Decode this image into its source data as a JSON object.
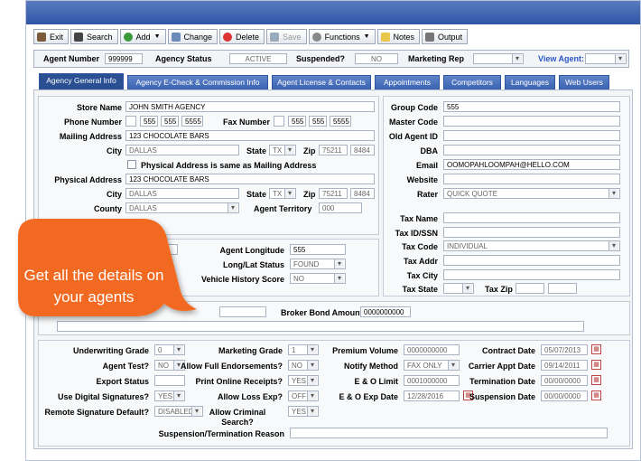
{
  "toolbar": {
    "exit": "Exit",
    "search": "Search",
    "add": "Add",
    "change": "Change",
    "delete": "Delete",
    "save": "Save",
    "functions": "Functions",
    "notes": "Notes",
    "output": "Output"
  },
  "header": {
    "agent_number_label": "Agent Number",
    "agent_number": "999999",
    "agent_status_label": "Agency Status",
    "agent_status": "ACTIVE",
    "suspended_label": "Suspended?",
    "suspended": "NO",
    "marketing_rep_label": "Marketing Rep",
    "view_agent_label": "View Agent:"
  },
  "tabs": [
    "Agency General Info",
    "Agency E-Check & Commission Info",
    "Agent License & Contacts",
    "Appointments",
    "Competitors",
    "Languages",
    "Web Users"
  ],
  "general": {
    "store_name_label": "Store Name",
    "store_name": "JOHN SMITH AGENCY",
    "phone_label": "Phone Number",
    "phone": [
      "555",
      "555",
      "5555"
    ],
    "fax_label": "Fax Number",
    "fax": [
      "555",
      "555",
      "5555"
    ],
    "mailing_label": "Mailing Address",
    "mailing": "123 CHOCOLATE BARS",
    "city_label": "City",
    "city": "DALLAS",
    "state_label": "State",
    "state": "TX",
    "zip_label": "Zip",
    "zip": "75211",
    "zip4": "8484",
    "same_as_mailing": "Physical Address is same as Mailing Address",
    "physical_label": "Physical Address",
    "physical": "123 CHOCOLATE BARS",
    "city2": "DALLAS",
    "state2": "TX",
    "zip2": "75211",
    "zip4_2": "8484",
    "county_label": "County",
    "county": "DALLAS",
    "territory_label": "Agent Territory",
    "territory": "000"
  },
  "right": {
    "group_code_label": "Group Code",
    "group_code": "555",
    "master_code_label": "Master Code",
    "old_agent_label": "Old Agent ID",
    "dba_label": "DBA",
    "email_label": "Email",
    "email": "OOMOPAHLOOMPAH@HELLO.COM",
    "website_label": "Website",
    "rater_label": "Rater",
    "rater": "QUICK QUOTE",
    "tax_name_label": "Tax Name",
    "tax_id_label": "Tax ID/SSN",
    "tax_code_label": "Tax Code",
    "tax_code": "INDIVIDUAL",
    "tax_addr_label": "Tax Addr",
    "tax_city_label": "Tax City",
    "tax_state_label": "Tax State",
    "tax_zip_label": "Tax Zip"
  },
  "geo": {
    "longitude_label": "Agent Longitude",
    "longitude": "555",
    "latlong_label": "Long/Lat Status",
    "latlong": "FOUND",
    "vehicle_label": "Vehicle History Score",
    "vehicle": "NO"
  },
  "broker": {
    "label": "Broker Bond Amount",
    "value": "0000000000"
  },
  "bottom": {
    "uw_grade_label": "Underwriting Grade",
    "uw_grade": "0",
    "mkt_grade_label": "Marketing Grade",
    "mkt_grade": "1",
    "premium_label": "Premium Volume",
    "premium": "0000000000",
    "contract_label": "Contract Date",
    "contract": "05/07/2013",
    "agent_test_label": "Agent Test?",
    "agent_test": "NO",
    "full_endorse_label": "Allow Full Endorsements?",
    "full_endorse": "NO",
    "notify_label": "Notify Method",
    "notify": "FAX ONLY",
    "carrier_label": "Carrier Appt Date",
    "carrier": "09/14/2011",
    "export_label": "Export Status",
    "print_label": "Print Online Receipts?",
    "print": "YES",
    "eo_limit_label": "E & O Limit",
    "eo_limit": "0001000000",
    "term_label": "Termination Date",
    "term": "00/00/0000",
    "digital_label": "Use Digital Signatures?",
    "digital": "YES",
    "loss_exp_label": "Allow Loss Exp?",
    "loss_exp": "OFF",
    "eo_exp_label": "E & O Exp Date",
    "eo_exp": "12/28/2016",
    "susp_label": "Suspension Date",
    "susp": "00/00/0000",
    "remote_label": "Remote Signature Default?",
    "remote": "DISABLED",
    "criminal_label": "Allow Criminal Search?",
    "criminal": "YES",
    "susp_reason_label": "Suspension/Termination Reason"
  },
  "callout": {
    "text": "Get all the details on your agents",
    "color": "#f26b21"
  }
}
